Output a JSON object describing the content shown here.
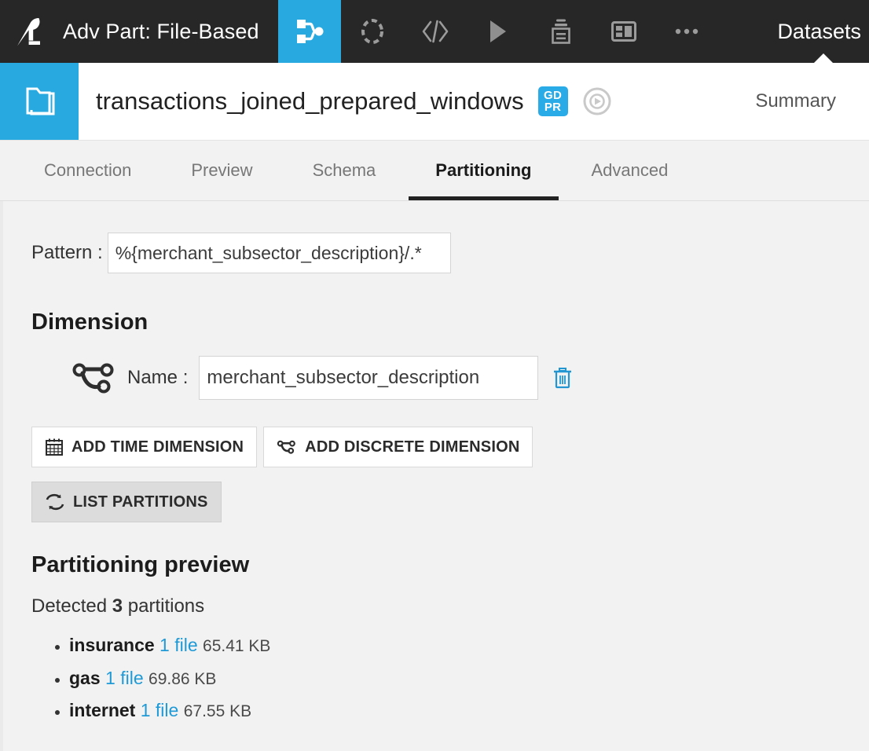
{
  "topbar": {
    "logo_icon": "dataiku-bird-logo",
    "project_title": "Adv Part: File-Based",
    "nav_items": [
      {
        "icon": "flow-icon",
        "label": "Flow",
        "active": true
      },
      {
        "icon": "lab-dashed-circle-icon",
        "label": "Lab",
        "active": false
      },
      {
        "icon": "code-brackets-icon",
        "label": "Code",
        "active": false
      },
      {
        "icon": "play-triangle-icon",
        "label": "Jobs",
        "active": false
      },
      {
        "icon": "stack-printer-icon",
        "label": "Automation",
        "active": false
      },
      {
        "icon": "dashboard-icon",
        "label": "Dashboards",
        "active": false
      },
      {
        "icon": "ellipsis-more-icon",
        "label": "More",
        "active": false
      }
    ],
    "datasets_label": "Datasets"
  },
  "dataset_header": {
    "folder_icon": "dataset-folder-icon",
    "title": "transactions_joined_prepared_windows",
    "gdpr_badge_line1": "GD",
    "gdpr_badge_line2": "PR",
    "compass_icon": "navigator-compass-icon",
    "summary_label": "Summary"
  },
  "tabs": [
    {
      "label": "Connection",
      "active": false
    },
    {
      "label": "Preview",
      "active": false
    },
    {
      "label": "Schema",
      "active": false
    },
    {
      "label": "Partitioning",
      "active": true
    },
    {
      "label": "Advanced",
      "active": false
    }
  ],
  "partitioning": {
    "pattern_label": "Pattern :",
    "pattern_value": "%{merchant_subsector_description}/.*",
    "dimension_heading": "Dimension",
    "dimension_icon": "discrete-dimension-graph-icon",
    "name_label": "Name :",
    "name_value": "merchant_subsector_description",
    "delete_icon": "trash-icon",
    "add_time_label": "ADD TIME DIMENSION",
    "add_time_icon": "calendar-icon",
    "add_discrete_label": "ADD DISCRETE DIMENSION",
    "add_discrete_icon": "discrete-dimension-graph-icon",
    "list_partitions_label": "LIST PARTITIONS",
    "list_partitions_icon": "refresh-sync-icon",
    "preview_heading": "Partitioning preview",
    "detected_prefix": "Detected",
    "detected_count": "3",
    "detected_suffix": "partitions",
    "partitions": [
      {
        "name": "insurance",
        "files": "1 file",
        "size": "65.41 KB"
      },
      {
        "name": "gas",
        "files": "1 file",
        "size": "69.86 KB"
      },
      {
        "name": "internet",
        "files": "1 file",
        "size": "67.55 KB"
      }
    ]
  },
  "colors": {
    "topbar_bg": "#272727",
    "accent_blue": "#28a9e0",
    "link_blue": "#1f9ad6",
    "page_bg": "#f2f2f2",
    "active_tab_underline": "#222222"
  }
}
